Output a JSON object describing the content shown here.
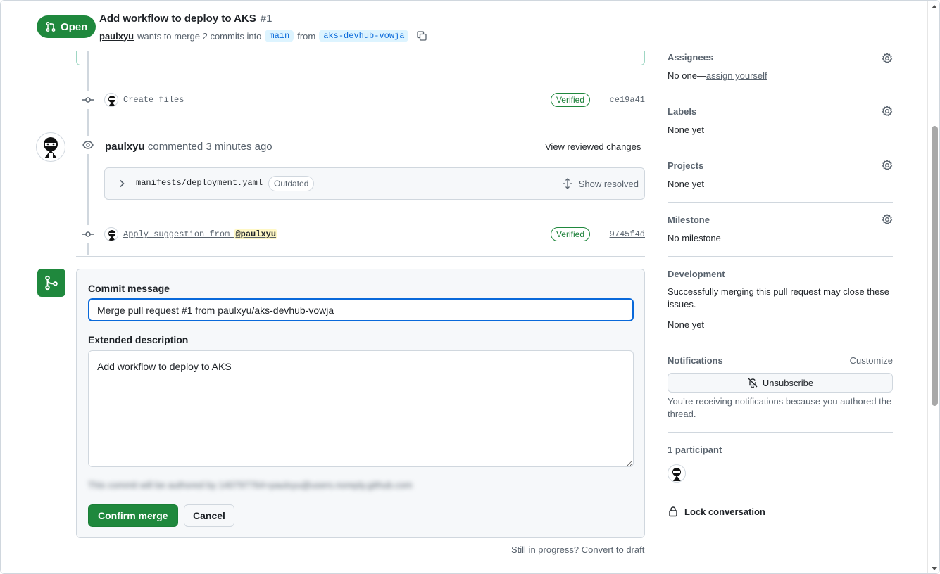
{
  "header": {
    "state": "Open",
    "title": "Add workflow to deploy to AKS",
    "number": "#1",
    "author": "paulxyu",
    "merge_text_1": "wants to merge 2 commits into",
    "base_branch": "main",
    "merge_text_2": "from",
    "head_branch": "aks-devhub-vowja"
  },
  "timeline": {
    "commit1": {
      "message": "Create files",
      "verified": "Verified",
      "sha": "ce19a41"
    },
    "review": {
      "author": "paulxyu",
      "action": "commented",
      "time": "3 minutes ago",
      "view_changes": "View reviewed changes",
      "file": "manifests/deployment.yaml",
      "outdated": "Outdated",
      "show_resolved": "Show resolved"
    },
    "commit2": {
      "message": "Apply suggestion from",
      "mention": "@paulxyu",
      "verified": "Verified",
      "sha": "9745f4d"
    }
  },
  "merge": {
    "commit_message_label": "Commit message",
    "commit_message_value": "Merge pull request #1 from paulxyu/aks-devhub-vowja",
    "extended_label": "Extended description",
    "extended_value": "Add workflow to deploy to AKS",
    "authored_note": "This commit will be authored by 140797764+paulxyu@users.noreply.github.com",
    "confirm_label": "Confirm merge",
    "cancel_label": "Cancel",
    "draft_prefix": "Still in progress?",
    "draft_link": "Convert to draft"
  },
  "sidebar": {
    "assignees": {
      "title": "Assignees",
      "value_prefix": "No one—",
      "value_link": "assign yourself"
    },
    "labels": {
      "title": "Labels",
      "value": "None yet"
    },
    "projects": {
      "title": "Projects",
      "value": "None yet"
    },
    "milestone": {
      "title": "Milestone",
      "value": "No milestone"
    },
    "development": {
      "title": "Development",
      "note": "Successfully merging this pull request may close these issues.",
      "value": "None yet"
    },
    "notifications": {
      "title": "Notifications",
      "customize": "Customize",
      "button": "Unsubscribe",
      "note": "You’re receiving notifications because you authored the thread."
    },
    "participants": {
      "title": "1 participant"
    },
    "lock": "Lock conversation"
  },
  "colors": {
    "accent_green": "#1f883d",
    "link_blue": "#0969da",
    "border": "#d0d7de",
    "muted_text": "#59636e"
  }
}
